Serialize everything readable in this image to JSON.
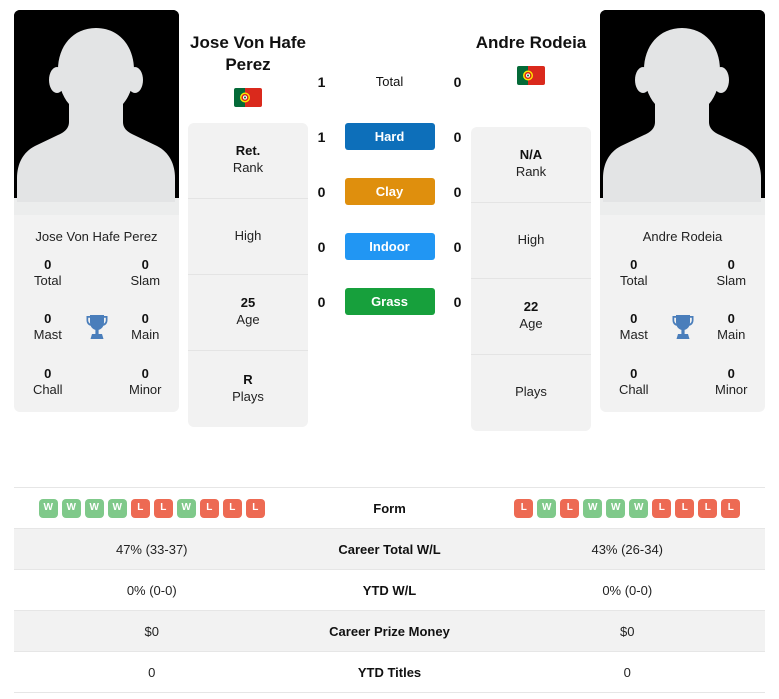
{
  "colors": {
    "hard": "#0d6fba",
    "clay": "#df8f0d",
    "indoor": "#2196f3",
    "grass": "#17a03c",
    "win_badge": "#7fc98a",
    "loss_badge": "#ed6a53",
    "card_bg": "#f2f2f2",
    "trophy": "#4a7ebb"
  },
  "players": {
    "left": {
      "display_name": "Jose Von Hafe Perez",
      "name_line1": "Jose Von Hafe",
      "name_line2": "Perez",
      "flag": "portugal-flag",
      "photo": "player-silhouette",
      "titles": {
        "total_value": "0",
        "total_label": "Total",
        "slam_value": "0",
        "slam_label": "Slam",
        "mast_value": "0",
        "mast_label": "Mast",
        "main_value": "0",
        "main_label": "Main",
        "chall_value": "0",
        "chall_label": "Chall",
        "minor_value": "0",
        "minor_label": "Minor",
        "trophy_icon": "trophy-icon"
      },
      "info": {
        "rank_value": "Ret.",
        "rank_label": "Rank",
        "high_value": "",
        "high_label": "High",
        "age_value": "25",
        "age_label": "Age",
        "plays_value": "R",
        "plays_label": "Plays"
      },
      "form": [
        "W",
        "W",
        "W",
        "W",
        "L",
        "L",
        "W",
        "L",
        "L",
        "L"
      ],
      "career_total_wl": "47% (33-37)",
      "ytd_wl": "0% (0-0)",
      "career_prize_money": "$0",
      "ytd_titles": "0"
    },
    "right": {
      "display_name": "Andre Rodeia",
      "name_line1": "Andre Rodeia",
      "name_line2": "",
      "flag": "portugal-flag",
      "photo": "player-silhouette",
      "titles": {
        "total_value": "0",
        "total_label": "Total",
        "slam_value": "0",
        "slam_label": "Slam",
        "mast_value": "0",
        "mast_label": "Mast",
        "main_value": "0",
        "main_label": "Main",
        "chall_value": "0",
        "chall_label": "Chall",
        "minor_value": "0",
        "minor_label": "Minor",
        "trophy_icon": "trophy-icon"
      },
      "info": {
        "rank_value": "N/A",
        "rank_label": "Rank",
        "high_value": "",
        "high_label": "High",
        "age_value": "22",
        "age_label": "Age",
        "plays_value": "",
        "plays_label": "Plays"
      },
      "form": [
        "L",
        "W",
        "L",
        "W",
        "W",
        "W",
        "L",
        "L",
        "L",
        "L"
      ],
      "career_total_wl": "43% (26-34)",
      "ytd_wl": "0% (0-0)",
      "career_prize_money": "$0",
      "ytd_titles": "0"
    }
  },
  "h2h": {
    "rows": [
      {
        "label": "Total",
        "left": "1",
        "right": "0",
        "style": "plain"
      },
      {
        "label": "Hard",
        "left": "1",
        "right": "0",
        "style": "hard"
      },
      {
        "label": "Clay",
        "left": "0",
        "right": "0",
        "style": "clay"
      },
      {
        "label": "Indoor",
        "left": "0",
        "right": "0",
        "style": "indoor"
      },
      {
        "label": "Grass",
        "left": "0",
        "right": "0",
        "style": "grass"
      }
    ]
  },
  "stats_table": {
    "rows": [
      {
        "label": "Form"
      },
      {
        "label": "Career Total W/L"
      },
      {
        "label": "YTD W/L"
      },
      {
        "label": "Career Prize Money"
      },
      {
        "label": "YTD Titles"
      }
    ]
  }
}
